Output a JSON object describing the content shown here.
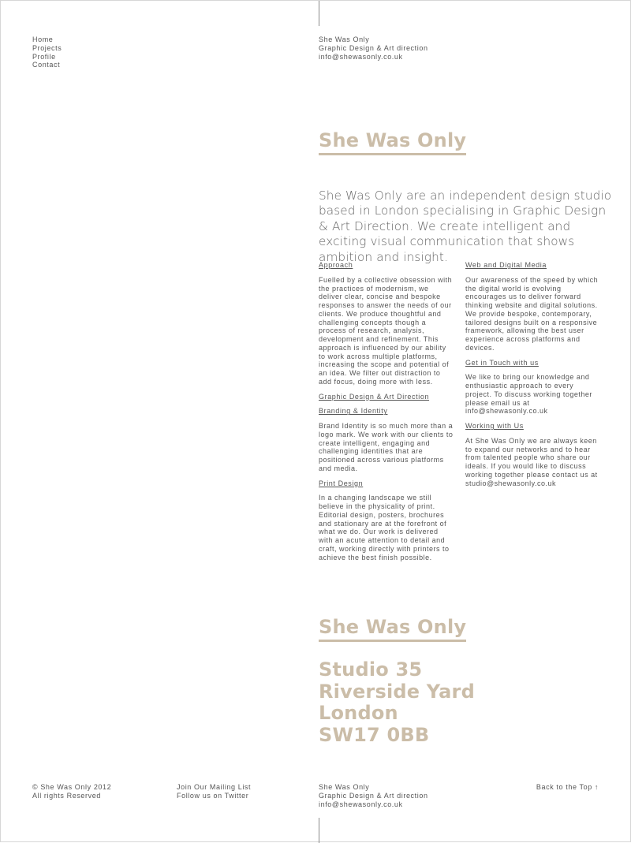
{
  "nav": {
    "items": [
      {
        "label": "Home"
      },
      {
        "label": "Projects"
      },
      {
        "label": "Profile"
      },
      {
        "label": "Contact"
      }
    ]
  },
  "header_info": {
    "name": "She Was Only",
    "tagline": "Graphic Design & Art direction",
    "email": "info@shewasonly.co.uk"
  },
  "profile": {
    "title": "She Was Only",
    "intro": "She Was Only are an independent design studio based in London specialising in Graphic Design & Art Direction. We create intelligent and exciting visual communication that shows ambition and insight.",
    "left_column": {
      "approach_heading": "Approach",
      "approach_text": "Fuelled by a collective obsession with the practices of modernism, we deliver clear, concise and bespoke responses to answer the needs of our clients. We produce thoughtful and challenging concepts though a process of research, analysis, development and refinement. This approach is influenced by our ability to work across multiple platforms, increasing the scope and potential of an idea. We filter out distraction to add focus, doing more with less.",
      "graphic_heading": "Graphic Design & Art Direction",
      "branding_heading": "Branding & Identity",
      "branding_text": "Brand Identity is so much more than a logo mark. We work with our clients to create intelligent, engaging and challenging identities that are positioned across various platforms and media.",
      "print_heading": "Print Design",
      "print_text": "In a changing landscape we still believe in the physicality of print. Editorial design, posters, brochures and stationary are at the forefront of what we do. Our work is delivered with an acute attention to detail and craft, working directly with printers to achieve the best finish possible."
    },
    "right_column": {
      "web_heading": "Web and Digital Media",
      "web_text": "Our awareness of the speed by which the digital world is evolving encourages us to deliver forward thinking website and digital solutions.",
      "web_text_2": "We provide bespoke, contemporary, tailored designs built on a responsive framework, allowing the best user experience across platforms and devices.",
      "touch_heading": "Get in Touch with us",
      "touch_text": "We like to bring our knowledge and enthusiastic approach to every project. To discuss working together please email us at info@shewasonly.co.uk",
      "working_heading": "Working with Us",
      "working_text": "At She Was Only we are always keen to expand our networks and to hear from talented people who share our ideals. If you would like to discuss working together please contact us at studio@shewasonly.co.uk"
    }
  },
  "contact": {
    "title": "She Was Only",
    "address_lines": [
      "Studio 35",
      "Riverside Yard",
      "London",
      "SW17 0BB"
    ]
  },
  "footer": {
    "copyright": "© She Was Only 2012",
    "rights": "All rights Reserved",
    "mailing_list": "Join Our Mailing List",
    "twitter": "Follow us on Twitter",
    "name": "She Was Only",
    "tagline": "Graphic Design & Art direction",
    "email": "info@shewasonly.co.uk",
    "back_to_top": "Back to the Top ↑"
  }
}
